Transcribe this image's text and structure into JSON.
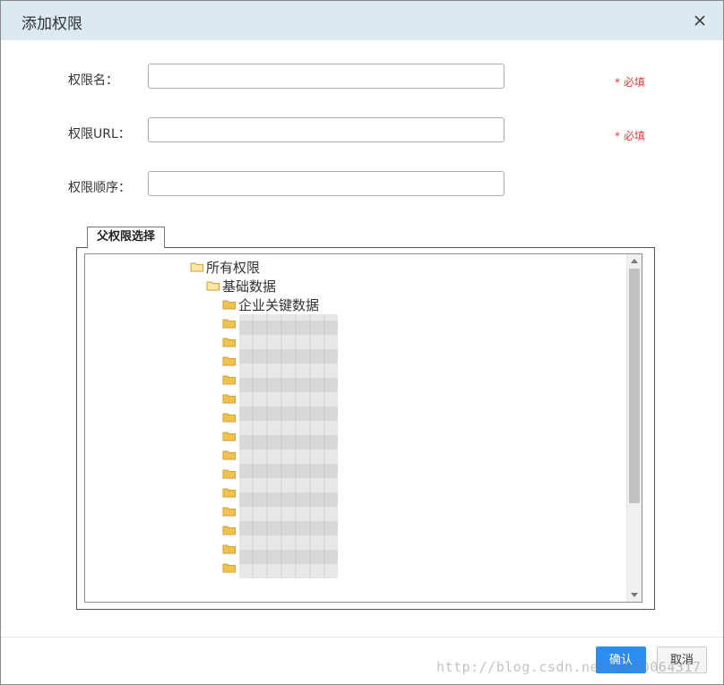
{
  "dialog": {
    "title": "添加权限",
    "close_icon": "close-icon"
  },
  "form": {
    "fields": [
      {
        "label": "权限名：",
        "value": "",
        "required_text": "* 必填"
      },
      {
        "label": "权限URL：",
        "value": "",
        "required_text": "* 必填"
      },
      {
        "label": "权限顺序：",
        "value": ""
      }
    ]
  },
  "tree_section": {
    "legend": "父权限选择",
    "root": "所有权限",
    "child": "基础数据",
    "leaf_first": "企业关键数据",
    "icon": "folder-icon"
  },
  "footer": {
    "ok_label": "确认",
    "cancel_label": "取消"
  },
  "watermark": "http://blog.csdn.net/u010064317",
  "colors": {
    "header_bg": "#dbe9f1",
    "required": "#e23b3b",
    "primary_button": "#2d8cf0",
    "folder": "#f2c14e"
  }
}
